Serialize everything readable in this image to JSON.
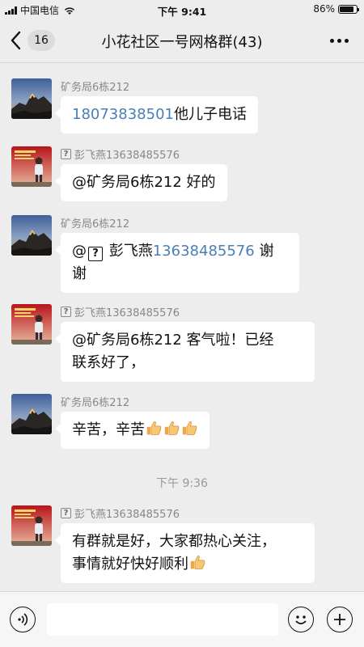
{
  "status_bar": {
    "carrier": "中国电信",
    "time": "下午 9:41",
    "battery_percent": "86%",
    "battery_level": 0.86
  },
  "nav": {
    "unread_count": "16",
    "title": "小花社区一号网格群(43)"
  },
  "messages": [
    {
      "sender": "矿务局6栋212",
      "avatar": "mountain-avatar",
      "phone": "18073838501",
      "text": "他儿子电话"
    },
    {
      "sender": "彭飞燕13638485576",
      "sender_icon": "unknown-emoji-icon",
      "avatar": "person-avatar",
      "text": "@矿务局6栋212 好的"
    },
    {
      "sender": "矿务局6栋212",
      "avatar": "mountain-avatar",
      "prefix": "@",
      "mention_name": "彭飞燕",
      "phone": "13638485576",
      "line1_suffix": " 谢",
      "line2": "谢"
    },
    {
      "sender": "彭飞燕13638485576",
      "sender_icon": "unknown-emoji-icon",
      "avatar": "person-avatar",
      "line1": "@矿务局6栋212 客气啦！已经",
      "line2": "联系好了，"
    },
    {
      "sender": "矿务局6栋212",
      "avatar": "mountain-avatar",
      "text": "辛苦，辛苦",
      "emojis": [
        "thumbs-up-icon",
        "thumbs-up-icon",
        "thumbs-up-icon"
      ]
    },
    {
      "sender": "彭飞燕13638485576",
      "sender_icon": "unknown-emoji-icon",
      "avatar": "person-avatar",
      "line1": "有群就是好，大家都热心关注，",
      "line2": "事情就好快好顺利",
      "emojis": [
        "thumbs-up-icon"
      ]
    }
  ],
  "time_divider": "下午 9:36",
  "input_bar": {
    "placeholder": "",
    "icons": [
      "voice-icon",
      "emoji-icon",
      "plus-icon"
    ]
  },
  "colors": {
    "background": "#ededed",
    "bubble": "#ffffff",
    "link": "#4a7fb5",
    "meta_text": "#888888"
  }
}
